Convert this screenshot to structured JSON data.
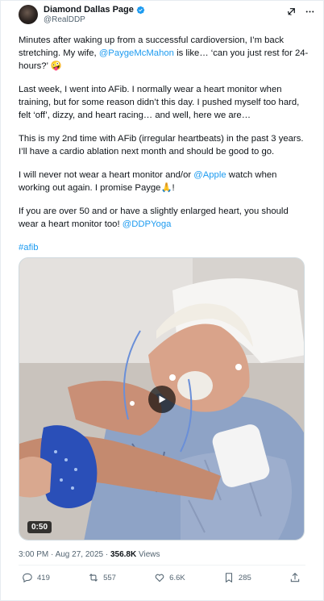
{
  "author": {
    "display_name": "Diamond Dallas Page",
    "handle": "@RealDDP"
  },
  "header_icons": [
    "grok-icon",
    "more-icon"
  ],
  "tweet": {
    "p1_pre": "Minutes after waking up from a successful cardioversion, I’m back stretching. My wife, ",
    "p1_mention": "@PaygeMcMahon",
    "p1_post": " is like… ‘can you just rest for 24-hours?’ 🤪",
    "p2": "Last week, I went into AFib. I normally wear a heart monitor when training, but for some reason didn’t this day. I pushed myself too hard, felt ‘off’, dizzy, and heart racing… and well, here we are…",
    "p3": "This is my 2nd time with AFib (irregular heartbeats) in the past 3 years. I’ll have a cardio ablation next month and should be good to go.",
    "p4_pre": "I will never not wear a heart monitor and/or ",
    "p4_mention": "@Apple",
    "p4_post": " watch when working out again. I promise Payge🙏!",
    "p5_pre": "If you are over 50 and or have a slightly enlarged heart, you should wear a heart monitor too! ",
    "p5_mention": "@DDPYoga",
    "hashtag": "#afib"
  },
  "video": {
    "duration": "0:50"
  },
  "meta": {
    "timestamp": "3:00 PM · Aug 27, 2025 · ",
    "views_count": "356.8K",
    "views_label": " Views"
  },
  "actions": {
    "replies": "419",
    "reposts": "557",
    "likes": "6.6K",
    "bookmarks": "285"
  }
}
